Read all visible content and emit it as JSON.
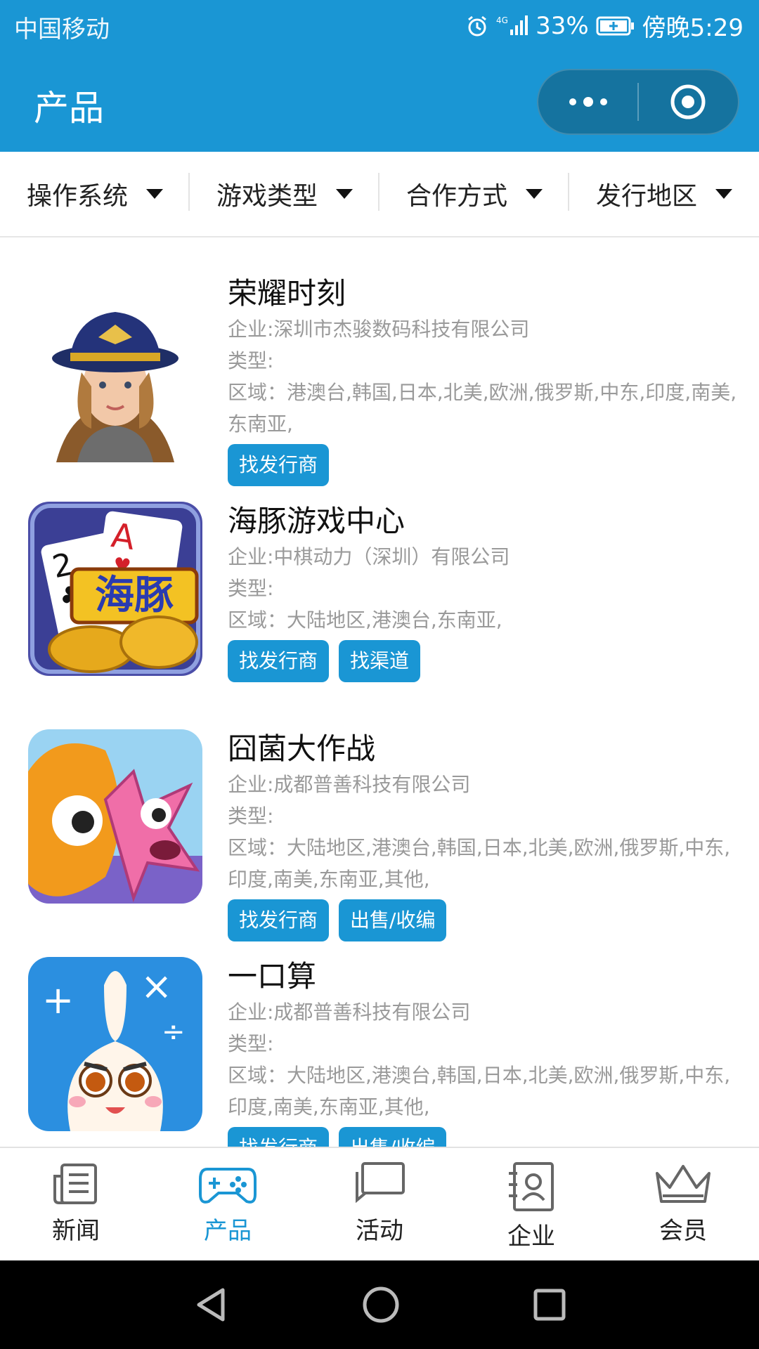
{
  "status_bar": {
    "carrier": "中国移动",
    "network": "4G",
    "battery": "33%",
    "time": "傍晚5:29"
  },
  "app_bar": {
    "title": "产品"
  },
  "filters": [
    {
      "label": "操作系统"
    },
    {
      "label": "游戏类型"
    },
    {
      "label": "合作方式"
    },
    {
      "label": "发行地区"
    }
  ],
  "products": [
    {
      "name": "荣耀时刻",
      "company": "企业:深圳市杰骏数码科技有限公司",
      "type": "类型:",
      "region": "区域：港澳台,韩国,日本,北美,欧洲,俄罗斯,中东,印度,南美,东南亚,",
      "tags": [
        "找发行商"
      ]
    },
    {
      "name": "海豚游戏中心",
      "company": "企业:中棋动力（深圳）有限公司",
      "type": "类型:",
      "region": "区域：大陆地区,港澳台,东南亚,",
      "tags": [
        "找发行商",
        "找渠道"
      ],
      "icon_text": "海豚"
    },
    {
      "name": "囧菌大作战",
      "company": "企业:成都普善科技有限公司",
      "type": "类型:",
      "region": "区域：大陆地区,港澳台,韩国,日本,北美,欧洲,俄罗斯,中东,印度,南美,东南亚,其他,",
      "tags": [
        "找发行商",
        "出售/收编"
      ]
    },
    {
      "name": "一口算",
      "company": "企业:成都普善科技有限公司",
      "type": "类型:",
      "region": "区域：大陆地区,港澳台,韩国,日本,北美,欧洲,俄罗斯,中东,印度,南美,东南亚,其他,",
      "tags": [
        "找发行商",
        "出售/收编"
      ]
    }
  ],
  "tab_bar": [
    {
      "label": "新闻",
      "icon": "news-icon"
    },
    {
      "label": "产品",
      "icon": "gamepad-icon",
      "active": true
    },
    {
      "label": "活动",
      "icon": "chat-icon"
    },
    {
      "label": "企业",
      "icon": "contact-card-icon"
    },
    {
      "label": "会员",
      "icon": "crown-icon"
    }
  ],
  "colors": {
    "accent": "#1a96d4",
    "capsule": "#15739f",
    "muted_text": "#9a9a9a"
  }
}
